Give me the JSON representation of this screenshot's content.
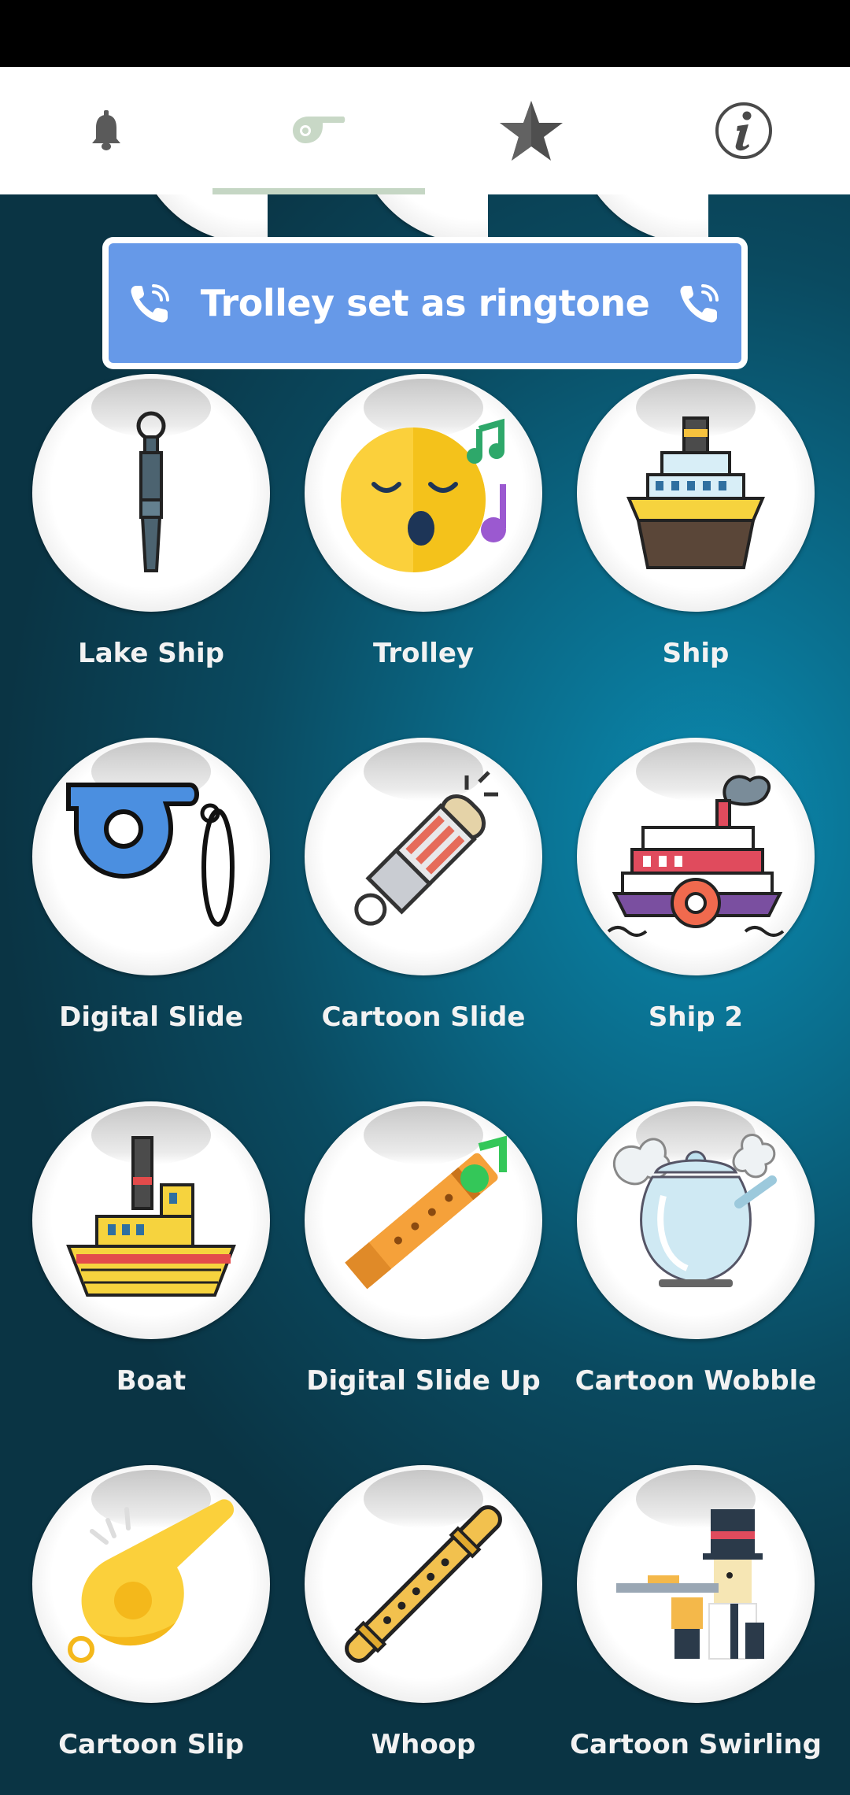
{
  "tabs": [
    {
      "name": "bell-icon",
      "active": false
    },
    {
      "name": "whistle-icon",
      "active": true
    },
    {
      "name": "star-icon",
      "active": false
    },
    {
      "name": "info-icon",
      "active": false
    }
  ],
  "toast": {
    "text": "Trolley set as ringtone"
  },
  "sounds": [
    {
      "label": "Lake Ship",
      "icon": "whistle-icon"
    },
    {
      "label": "Trolley",
      "icon": "singing-emoji-icon"
    },
    {
      "label": "Ship",
      "icon": "ship-icon"
    },
    {
      "label": "Digital Slide",
      "icon": "whistle-icon"
    },
    {
      "label": "Cartoon Slide",
      "icon": "whistle-icon"
    },
    {
      "label": "Ship 2",
      "icon": "steamboat-icon"
    },
    {
      "label": "Boat",
      "icon": "boat-icon"
    },
    {
      "label": "Digital Slide Up",
      "icon": "flute-icon"
    },
    {
      "label": "Cartoon Wobble",
      "icon": "kettle-icon"
    },
    {
      "label": "Cartoon Slip",
      "icon": "whistle-icon"
    },
    {
      "label": "Whoop",
      "icon": "recorder-icon"
    },
    {
      "label": "Cartoon Swirling",
      "icon": "flute-player-icon"
    }
  ]
}
